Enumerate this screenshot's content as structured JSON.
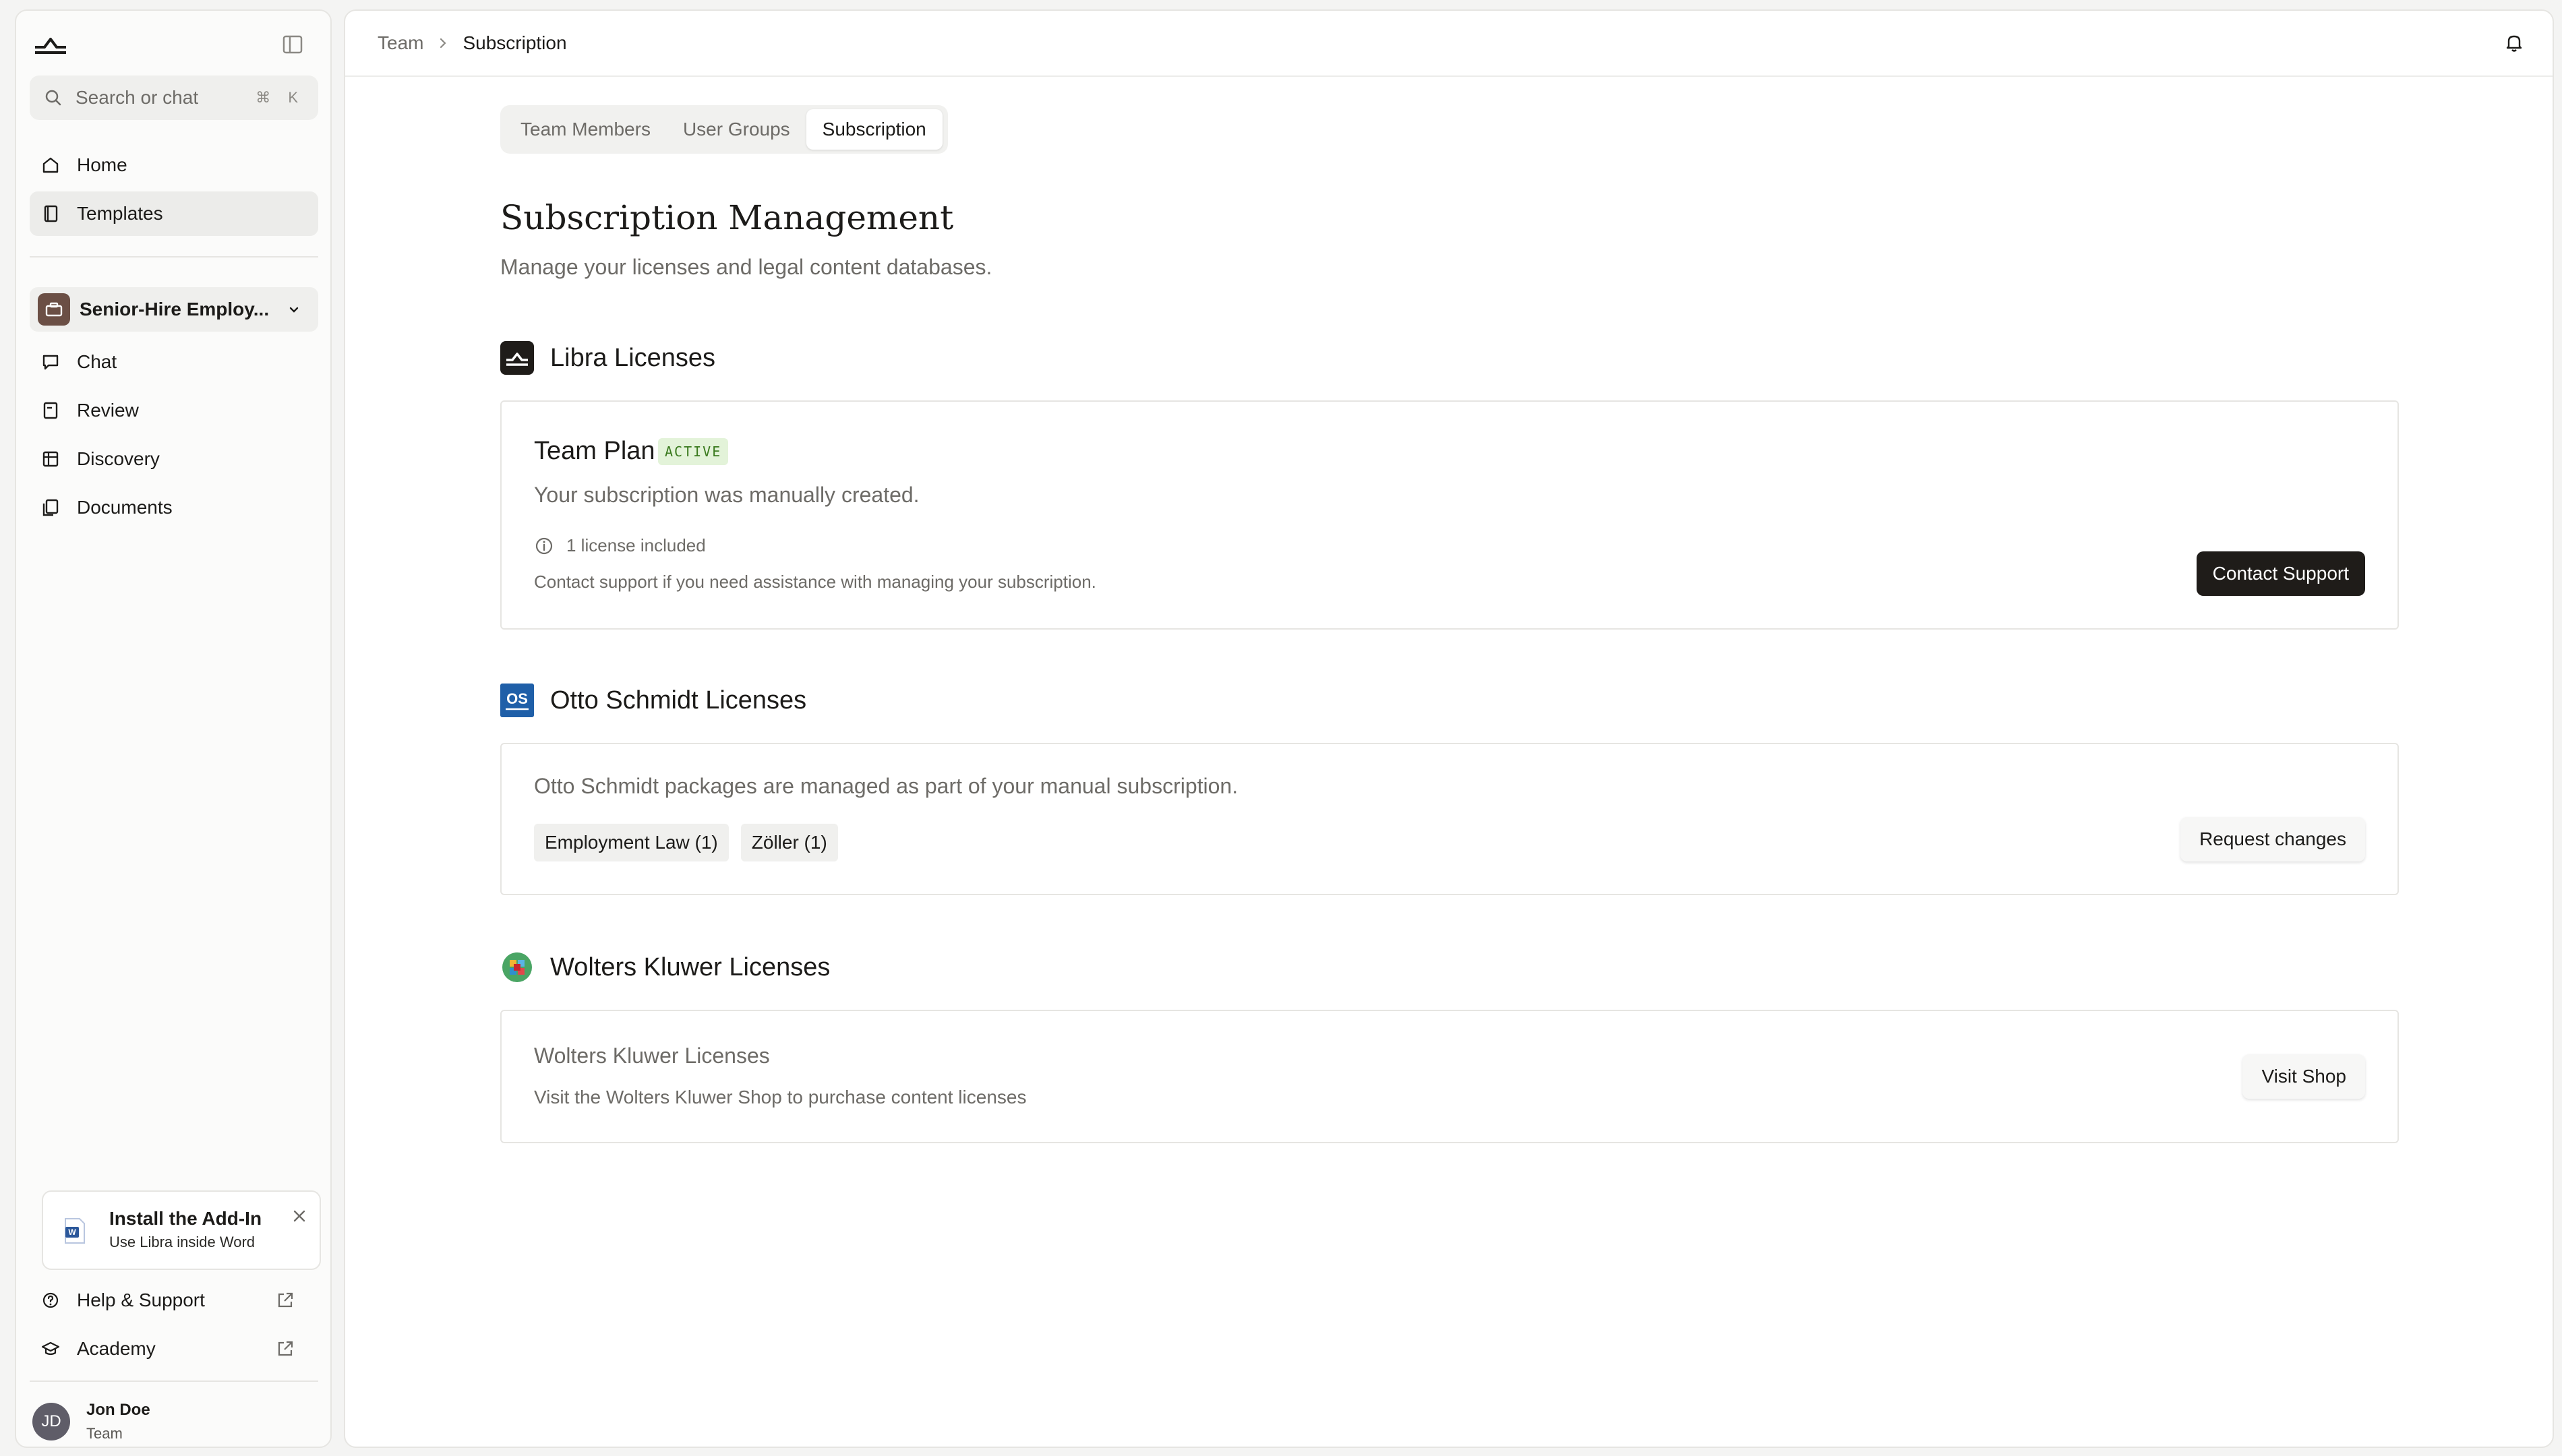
{
  "sidebar": {
    "search_placeholder": "Search or chat",
    "search_shortcut": "⌘ K",
    "primary_nav": [
      {
        "label": "Home",
        "icon": "home-icon"
      },
      {
        "label": "Templates",
        "icon": "book-icon",
        "active": true
      }
    ],
    "workspace": {
      "name": "Senior-Hire Employ...",
      "icon": "briefcase-icon"
    },
    "workspace_nav": [
      {
        "label": "Chat",
        "icon": "chat-icon"
      },
      {
        "label": "Review",
        "icon": "review-icon"
      },
      {
        "label": "Discovery",
        "icon": "table-icon"
      },
      {
        "label": "Documents",
        "icon": "documents-icon"
      }
    ],
    "addin": {
      "title": "Install the Add-In",
      "subtitle": "Use Libra inside Word"
    },
    "bottom_nav": [
      {
        "label": "Help & Support",
        "icon": "help-icon"
      },
      {
        "label": "Academy",
        "icon": "graduation-cap-icon"
      }
    ],
    "user": {
      "initials": "JD",
      "name": "Jon Doe",
      "role": "Team"
    }
  },
  "header": {
    "breadcrumb": [
      "Team",
      "Subscription"
    ]
  },
  "tabs": [
    {
      "label": "Team Members",
      "active": false
    },
    {
      "label": "User Groups",
      "active": false
    },
    {
      "label": "Subscription",
      "active": true
    }
  ],
  "page": {
    "title": "Subscription Management",
    "subtitle": "Manage your licenses and legal content databases."
  },
  "libra": {
    "heading": "Libra Licenses",
    "plan_name": "Team Plan",
    "status": "ACTIVE",
    "description": "Your subscription was manually created.",
    "licenses": "1 license included",
    "help_text": "Contact support if you need assistance with managing your subscription.",
    "button": "Contact Support"
  },
  "otto": {
    "heading": "Otto Schmidt Licenses",
    "logo_text": "OS",
    "description": "Otto Schmidt packages are managed as part of your manual subscription.",
    "packages": [
      "Employment Law (1)",
      "Zöller (1)"
    ],
    "button": "Request changes"
  },
  "wolters": {
    "heading": "Wolters Kluwer Licenses",
    "card_title": "Wolters Kluwer Licenses",
    "card_text": "Visit the Wolters Kluwer Shop to purchase content licenses",
    "button": "Visit Shop"
  },
  "colors": {
    "accent_dark": "#1f1c19",
    "active_badge_bg": "#e3f3d9",
    "active_badge_text": "#3a7a1e",
    "otto_blue": "#1f5fa8"
  }
}
